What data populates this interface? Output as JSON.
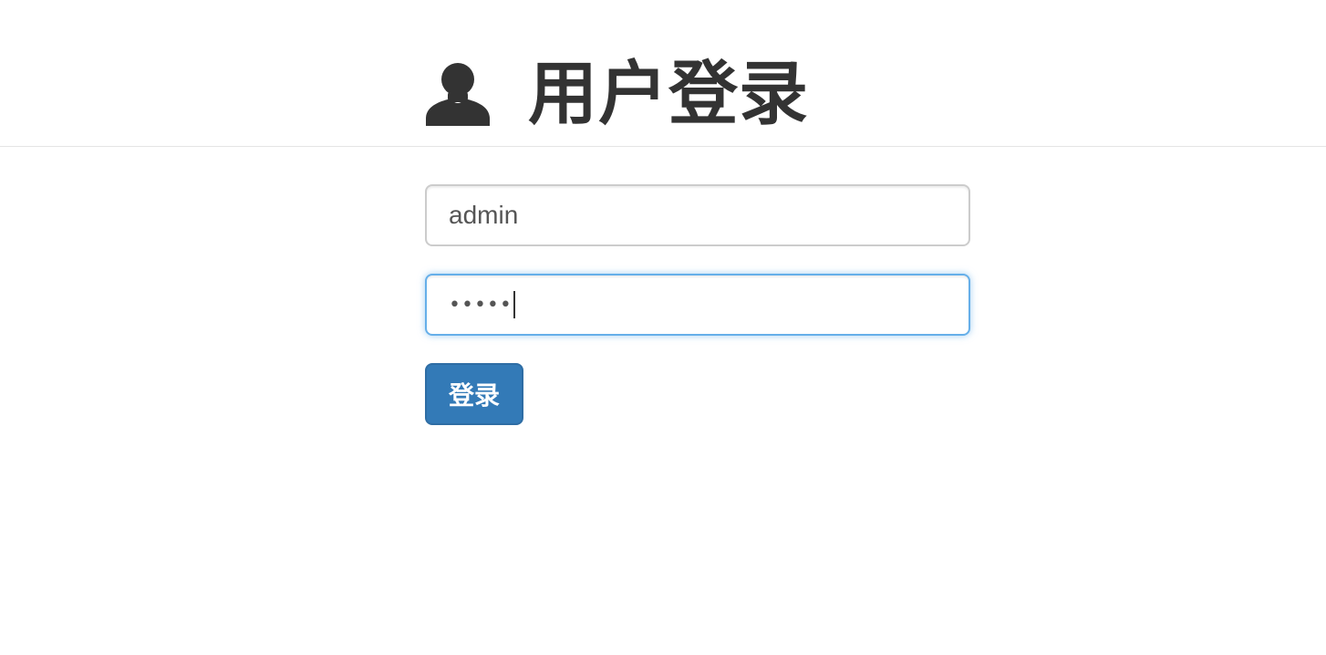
{
  "header": {
    "icon": "user-icon",
    "title": "用户登录"
  },
  "form": {
    "username": {
      "value": "admin"
    },
    "password": {
      "masked_value": "•••••"
    },
    "submit_label": "登录"
  },
  "colors": {
    "primary": "#337ab7",
    "primary_border": "#2e6da4",
    "focus_border": "#66afe9",
    "text": "#333333"
  }
}
